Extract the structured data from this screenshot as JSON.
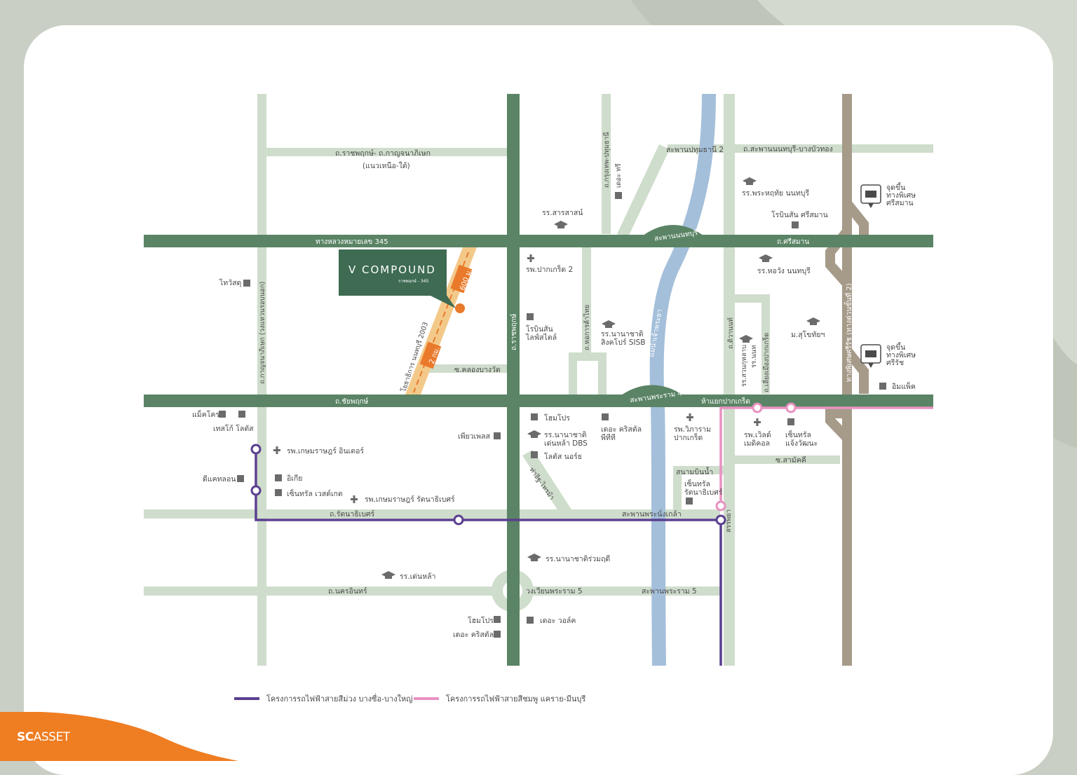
{
  "colors": {
    "road_main": "#5a8465",
    "road_minor": "#cfddcc",
    "river": "#a4bfda",
    "expressway": "#a69a89",
    "purple_line": "#5a3f8f",
    "pink_line": "#e991c1",
    "marker_orange": "#ea7a2b",
    "project_box": "#3e6b52",
    "brand_orange": "#ef7d22"
  },
  "project": {
    "name": "V COMPOUND",
    "sub": "ราชพฤกษ์ - 345",
    "dist_600": "600 ม.",
    "dist_2km": "2 กม."
  },
  "roads": {
    "north_south_top": "ถ.ราชพฤกษ์- ถ.กาญจนาภิเษก",
    "north_south_top2": "(แนวเหนือ-ใต้)",
    "hw345": "ทางหลวงหมายเลข 345",
    "sisaman": "ถ.ศรีสมาน",
    "nonthaburi_bridge": "สะพานนนทบุรี",
    "pathum_bridge": "สะพานปทุมธานี 2",
    "nonthaburi_bangbuathong": "ถ.สะพานนนทบุรี-บางบัวทอง",
    "chaiyaphruek": "ถ.ชัยพฤกษ์",
    "rama4_bridge": "สะพานพระราม 4",
    "pakkret_junction": "ห้าแยกปากเกร็ด",
    "ratanathibet": "ถ.รัตนาธิเบศร์",
    "nangklao_bridge": "สะพานพระนั่งเกล้า",
    "nakhon_in": "ถ.นครอินทร์",
    "rama5_circle": "วงเวียนพระราม 5",
    "rama5_bridge": "สะพานพระราม 5",
    "samakkhi": "ซ.สามัคคี",
    "khlong_bang_wat": "ซ.คลองบางวัด",
    "ratchaphruek": "ถ.ราชพฤกษ์",
    "kanchanaphisek": "ถ.กาญจนาภิเษก (วงแหวนรอบนอก)",
    "krungthep_pathum": "ถ.กรุงเทพ-ปทุมธานี",
    "hospital_road": "ถ.หอการค้าไทย",
    "tiwanon": "ถ.ติวานนท์",
    "chaeng_pakkret": "ถ.เลี่ยงเมืองปากเกร็ด",
    "kanchanaphisek_ns": "โยธาธิการ นนทบุรี 2003",
    "tha_it": "ท่าอิฐ-ไทรม้า",
    "chaengwattana_short": "สรรพยา",
    "river": "แม่น้ำเจ้าพระยา",
    "expressway": "ทางพิเศษศรีรัช (ทางด่วนขั้นที่ 2)"
  },
  "places": {
    "the_tree": "เดอะ ทรี",
    "sarasas": "รร.สารสาสน์",
    "rs_pakkret2": "รพ.ปากเกร็ด 2",
    "robinson_lifestyle_1": "โรบินสัน",
    "robinson_lifestyle_2": "ไลฟ์สไตล์",
    "sisb_1": "รร.นานาชาติ",
    "sisb_2": "สิงคโปร์ SISB",
    "phrahruthai": "รร.พระหฤทัย นนทบุรี",
    "robinson_sisaman": "โรบินสัน ศรีสมาน",
    "horwang": "รร.หอวัง นนทบุรี",
    "sukhothai": "ม.สุโขทัยฯ",
    "kanchanaphisek_school_1": "รร.นนท",
    "kanchanaphisek_school_2": "ทุกรบัญ",
    "kanchanaphisek_school_3": "รร.สวนกุหลาบ",
    "exp1_1": "จุดขึ้น",
    "exp1_2": "ทางพิเศษ",
    "exp1_3": "ศรีสมาน",
    "exp2_1": "จุดขึ้น",
    "exp2_2": "ทางพิเศษ",
    "exp2_3": "ศรีรัช",
    "impact": "อิมแพ็ค",
    "thaiwatsadu": "ไทวัสดุ",
    "makro": "แม็คโคร",
    "tesco": "เทสโก้ โลตัส",
    "kasemrad_inter": "รพ.เกษมราษฎร์ อินเตอร์",
    "decathlon": "ดีแคทลอน",
    "ikea": "อิเกีย",
    "central_westgate": "เซ็นทรัล เวสต์เกต",
    "kasemrad_ratana": "รพ.เกษมราษฎร์ รัตนาธิเบศร์",
    "pure_place": "เพียวเพลส",
    "homepro1": "โฮมโปร",
    "dbs_1": "รร.นานาชาติ",
    "dbs_2": "เด่นหล้า DBS",
    "lotus_north": "โลตัส นอร์ธ",
    "crystal_pt_1": "เดอะ คริสตัล",
    "crystal_pt_2": "พีทีที",
    "vibharam_1": "รพ.วิภาราม",
    "vibharam_2": "ปากเกร็ด",
    "world_medical_1": "รพ.เวิลด์",
    "world_medical_2": "เมดิคอล",
    "central_chaeng_1": "เซ็นทรัล",
    "central_chaeng_2": "แจ้งวัฒนะ",
    "sanambinnam": "สนามบินน้ำ",
    "central_ratana_1": "เซ็นทรัล",
    "central_ratana_2": "รัตนาธิเบศร์",
    "ruamrudee": "รร.นานาชาติร่วมฤดี",
    "denla": "รร.เด่นหล้า",
    "homepro2": "โฮมโปร",
    "crystal": "เดอะ คริสตัล",
    "the_walk": "เดอะ วอล์ค"
  },
  "legend": {
    "purple": "โครงการรถไฟฟ้าสายสีม่วง บางซื่อ-บางใหญ่",
    "pink": "โครงการรถไฟฟ้าสายสีชมพู แคราย-มีนบุรี"
  },
  "brand": {
    "sc": "SC",
    "asset": "ASSET"
  }
}
